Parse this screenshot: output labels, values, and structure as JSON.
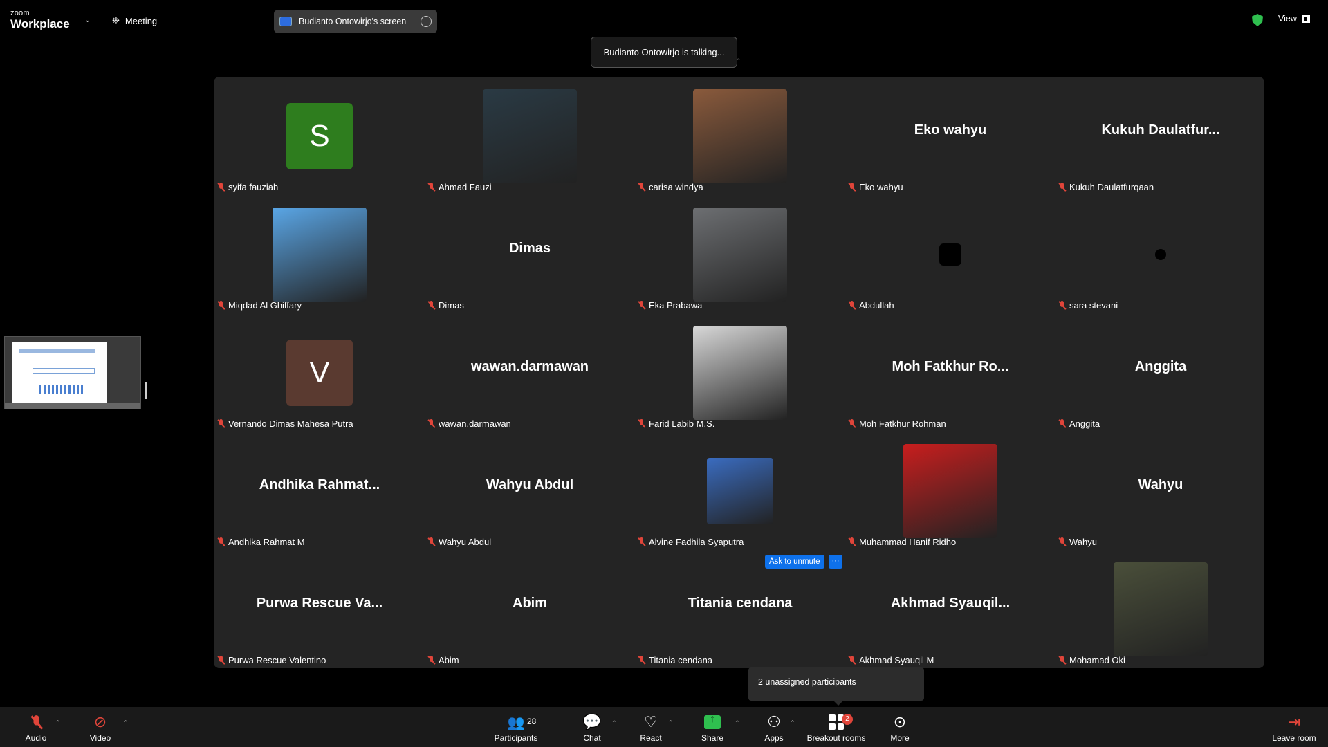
{
  "app": {
    "brand_small": "zoom",
    "brand_big": "Workplace"
  },
  "topbar": {
    "meeting_label": "Meeting",
    "share_label": "Budianto Ontowirjo's screen",
    "view_label": "View"
  },
  "talking_banner": "Budianto Ontowirjo is talking...",
  "participants": [
    {
      "name": "syifa fauziah",
      "display": "letter",
      "letter": "S",
      "color": "#2e7d1e"
    },
    {
      "name": "Ahmad Fauzi",
      "display": "photo",
      "color": "#2a3a44"
    },
    {
      "name": "carisa windya",
      "display": "photo",
      "color": "#8a5a3c"
    },
    {
      "name": "Eko wahyu",
      "display": "text",
      "text": "Eko wahyu"
    },
    {
      "name": "Kukuh Daulatfurqaan",
      "display": "text",
      "text": "Kukuh  Daulatfur..."
    },
    {
      "name": "Miqdad Al Ghiffary",
      "display": "photo",
      "color": "#5aa6e6"
    },
    {
      "name": "Dimas",
      "display": "text",
      "text": "Dimas"
    },
    {
      "name": "Eka Prabawa",
      "display": "photo",
      "color": "#6d6f72"
    },
    {
      "name": "Abdullah",
      "display": "square"
    },
    {
      "name": "sara stevani",
      "display": "dot"
    },
    {
      "name": "Vernando Dimas Mahesa Putra",
      "display": "letter",
      "letter": "V",
      "color": "#5a3a30"
    },
    {
      "name": "wawan.darmawan",
      "display": "text",
      "text": "wawan.darmawan"
    },
    {
      "name": "Farid Labib M.S.",
      "display": "photo",
      "color": "#d8d8d8"
    },
    {
      "name": "Moh Fatkhur Rohman",
      "display": "text",
      "text": "Moh  Fatkhur  Ro..."
    },
    {
      "name": "Anggita",
      "display": "text",
      "text": "Anggita"
    },
    {
      "name": "Andhika Rahmat M",
      "display": "text",
      "text": "Andhika  Rahmat..."
    },
    {
      "name": "Wahyu Abdul",
      "display": "text",
      "text": "Wahyu Abdul"
    },
    {
      "name": "Alvine Fadhila Syaputra",
      "display": "photo-sm",
      "color": "#3a6cc0"
    },
    {
      "name": "Muhammad Hanif Ridho",
      "display": "photo",
      "color": "#c81e1e"
    },
    {
      "name": "Wahyu",
      "display": "text",
      "text": "Wahyu"
    },
    {
      "name": "Purwa Rescue Valentino",
      "display": "text",
      "text": "Purwa Rescue  Va..."
    },
    {
      "name": "Abim",
      "display": "text",
      "text": "Abim"
    },
    {
      "name": "Titania cendana",
      "display": "text",
      "text": "Titania cendana"
    },
    {
      "name": "Akhmad Syauqil M",
      "display": "text",
      "text": "Akhmad  Syauqil..."
    },
    {
      "name": "Mohamad Oki",
      "display": "photo",
      "color": "#4a4f3a"
    }
  ],
  "ask_to_unmute": "Ask to unmute",
  "unassigned": "2 unassigned participants",
  "toolbar": {
    "audio": "Audio",
    "video": "Video",
    "participants": "Participants",
    "participants_count": "28",
    "chat": "Chat",
    "react": "React",
    "share": "Share",
    "apps": "Apps",
    "breakout": "Breakout rooms",
    "breakout_badge": "2",
    "more": "More",
    "leave": "Leave room"
  }
}
